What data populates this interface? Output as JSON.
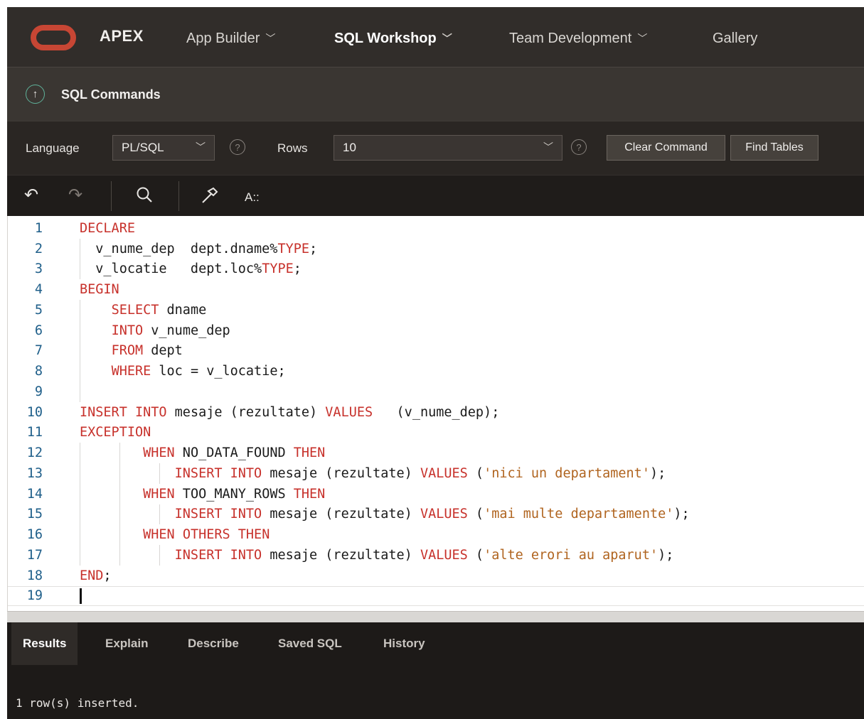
{
  "nav": {
    "brand": "APEX",
    "items": [
      {
        "label": "App Builder",
        "has_menu": true
      },
      {
        "label": "SQL Workshop",
        "has_menu": true,
        "active": true
      },
      {
        "label": "Team Development",
        "has_menu": true
      },
      {
        "label": "Gallery",
        "has_menu": false
      }
    ]
  },
  "page": {
    "title": "SQL Commands",
    "up_icon": "arrow-up"
  },
  "options": {
    "language_label": "Language",
    "language_value": "PL/SQL",
    "rows_label": "Rows",
    "rows_value": "10",
    "clear_button": "Clear Command",
    "find_button": "Find Tables"
  },
  "editor_toolbar": {
    "undo_icon": "↶",
    "redo_icon": "↷",
    "search_icon": "⚲",
    "format_icon": "⚒",
    "autocomplete_label": "A::"
  },
  "code_lines": [
    "DECLARE",
    "  v_nume_dep  dept.dname%TYPE;",
    "  v_locatie   dept.loc%TYPE;",
    "BEGIN",
    "    SELECT dname",
    "    INTO v_nume_dep",
    "    FROM dept",
    "    WHERE loc = v_locatie;",
    "",
    "INSERT INTO mesaje (rezultate) VALUES   (v_nume_dep);",
    "EXCEPTION",
    "        WHEN NO_DATA_FOUND THEN",
    "            INSERT INTO mesaje (rezultate) VALUES ('nici un departament');",
    "        WHEN TOO_MANY_ROWS THEN",
    "            INSERT INTO mesaje (rezultate) VALUES ('mai multe departamente');",
    "        WHEN OTHERS THEN",
    "            INSERT INTO mesaje (rezultate) VALUES ('alte erori au aparut');",
    "END;",
    ""
  ],
  "results": {
    "tabs": [
      "Results",
      "Explain",
      "Describe",
      "Saved SQL",
      "History"
    ],
    "active_tab": "Results",
    "message": "1 row(s) inserted."
  },
  "colors": {
    "brand_red": "#c74634",
    "keyword": "#c7312b",
    "string": "#b0641f",
    "line_number": "#1f5f8a",
    "nav_bg": "#312d2a"
  }
}
